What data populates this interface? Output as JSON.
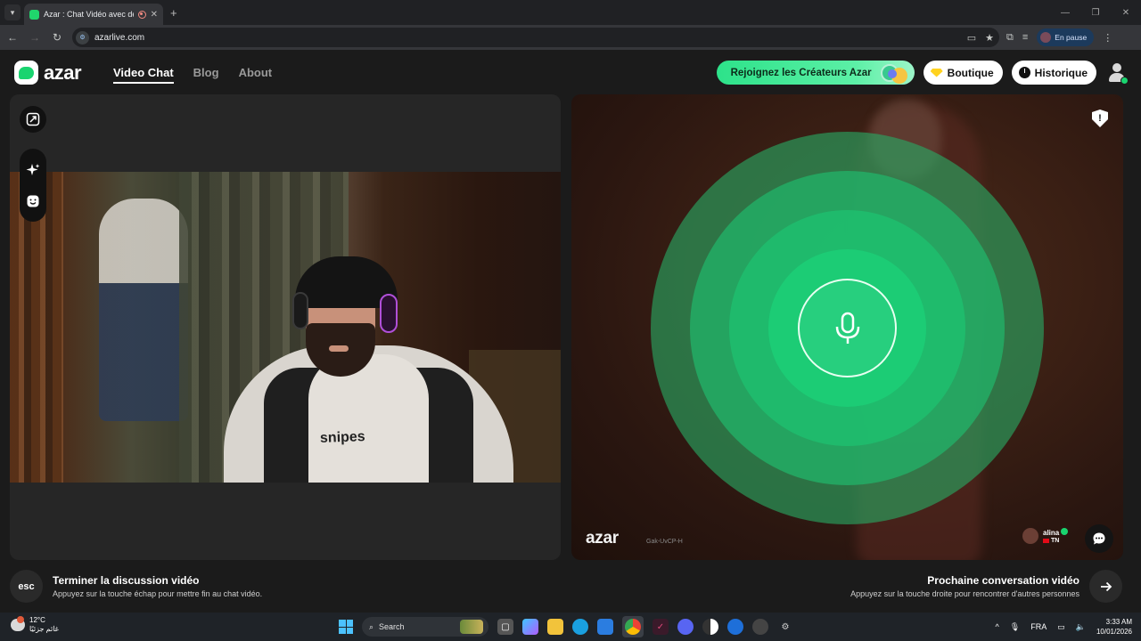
{
  "browser": {
    "tab_title": "Azar : Chat Vidéo avec de n",
    "url": "azarlive.com",
    "profile_label": "En pause"
  },
  "header": {
    "logo_text": "azar",
    "nav": [
      {
        "label": "Video Chat",
        "active": true
      },
      {
        "label": "Blog",
        "active": false
      },
      {
        "label": "About",
        "active": false
      }
    ],
    "creators_label": "Rejoignez les Créateurs Azar",
    "shop_label": "Boutique",
    "history_label": "Historique"
  },
  "remote": {
    "watermark": "azar",
    "session_id": "Gak-UvCP-H",
    "peer_name": "alina",
    "peer_country": "TN"
  },
  "bottom": {
    "esc_label": "esc",
    "end_title": "Terminer la discussion vidéo",
    "end_sub": "Appuyez sur la touche échap pour mettre fin au chat vidéo.",
    "next_title": "Prochaine conversation vidéo",
    "next_sub": "Appuyez sur la touche droite pour rencontrer d'autres personnes"
  },
  "camera": {
    "shirt_text": "snipes"
  },
  "taskbar": {
    "temp": "12°C",
    "weather_desc": "غائم جزئيًا",
    "search_label": "Search",
    "language": "FRA",
    "time": "3:33 AM",
    "date": "10/01/2026"
  },
  "colors": {
    "accent_green": "#19d46f",
    "background": "#1b1b1b"
  }
}
